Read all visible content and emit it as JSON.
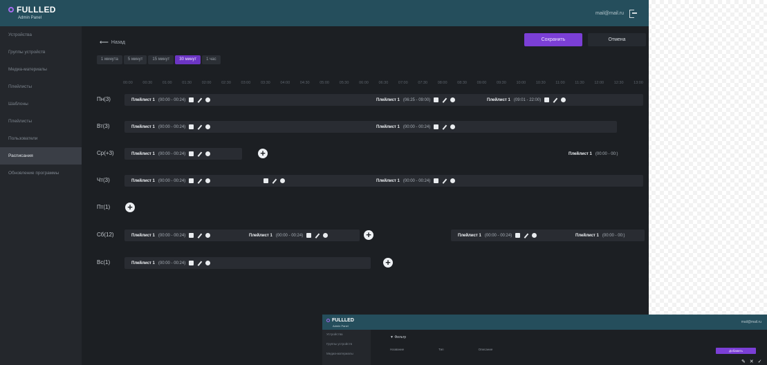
{
  "header": {
    "brand": "FULLLED",
    "subtitle": "Admin Panel",
    "user": "mail@mail.ru"
  },
  "sidebar": {
    "items": [
      {
        "label": "Устройства",
        "active": false
      },
      {
        "label": "Группы устройств",
        "active": false
      },
      {
        "label": "Медиа-материалы",
        "active": false
      },
      {
        "label": "Плейлисты",
        "active": false
      },
      {
        "label": "Шаблоны",
        "active": false
      },
      {
        "label": "Плейлисты",
        "active": false
      },
      {
        "label": "Пользователи",
        "active": false
      },
      {
        "label": "Расписания",
        "active": true
      },
      {
        "label": "Обновление программы",
        "active": false
      }
    ]
  },
  "toolbar": {
    "back_label": "Назад",
    "save_label": "Сохранить",
    "cancel_label": "Отмена"
  },
  "intervals": [
    {
      "label": "1 минута",
      "active": false
    },
    {
      "label": "5 минут",
      "active": false
    },
    {
      "label": "15 минут",
      "active": false
    },
    {
      "label": "30 минут",
      "active": true
    },
    {
      "label": "1 час",
      "active": false
    }
  ],
  "hours": [
    "00:00",
    "00:30",
    "01:00",
    "01:30",
    "02:00",
    "02:30",
    "03:00",
    "03:30",
    "04:00",
    "04:30",
    "05:00",
    "05:30",
    "06:00",
    "06:30",
    "07:00",
    "07:30",
    "08:00",
    "08:30",
    "09:00",
    "09:30",
    "10:00",
    "10:30",
    "11:00",
    "11:30",
    "12:00",
    "12:30",
    "13:00"
  ],
  "days": [
    {
      "label": "Пн(3)",
      "segments": [
        {
          "name": "Плейлист 1",
          "time": "(00:00 - 00:24)"
        },
        {
          "name": "Плейлист 1",
          "time": "(06:25 - 09:00)"
        },
        {
          "name": "Плейлист 1",
          "time": "(09:01 - 22:00)"
        }
      ]
    },
    {
      "label": "Вт(3)",
      "segments": [
        {
          "name": "Плейлист 1",
          "time": "(00:00 - 00:24)"
        },
        {
          "name": "Плейлист 1",
          "time": "(00:00 - 00:24)"
        }
      ]
    },
    {
      "label": "Ср(+3)",
      "segments": [
        {
          "name": "Плейлист 1",
          "time": "(00:00 - 00:24)"
        },
        {
          "name": "Плейлист 1",
          "time": "(00:00 - 00:)"
        }
      ]
    },
    {
      "label": "Чт(3)",
      "segments": [
        {
          "name": "Плейлист 1",
          "time": "(00:00 - 00:24)"
        },
        {
          "name": "",
          "time": ""
        },
        {
          "name": "Плейлист 1",
          "time": "(00:00 - 00:24)"
        }
      ]
    },
    {
      "label": "Пт(1)",
      "segments": []
    },
    {
      "label": "Сб(12)",
      "segments": [
        {
          "name": "Плейлист 1",
          "time": "(00:00 - 00:24)"
        },
        {
          "name": "Плейлист 1",
          "time": "(00:00 - 00:24)"
        },
        {
          "name": "Плейлист 1",
          "time": "(00:00 - 00:24)"
        },
        {
          "name": "Плейлист 1",
          "time": "(00:00 - 00:)"
        }
      ]
    },
    {
      "label": "Вс(1)",
      "segments": [
        {
          "name": "Плейлист 1",
          "time": "(00:00 - 00:24)"
        }
      ]
    }
  ],
  "second_screenshot": {
    "brand": "FULLLED",
    "subtitle": "Admin Panel",
    "user": "mail@mail.ru",
    "sidebar": [
      "Устройства",
      "Группы устройств",
      "Медиа-материалы"
    ],
    "filter_label": "Фильтр",
    "columns": [
      "Название",
      "Тип",
      "Описание"
    ],
    "add_label": "Добавить",
    "actions": "✎ ✕ ✓"
  }
}
